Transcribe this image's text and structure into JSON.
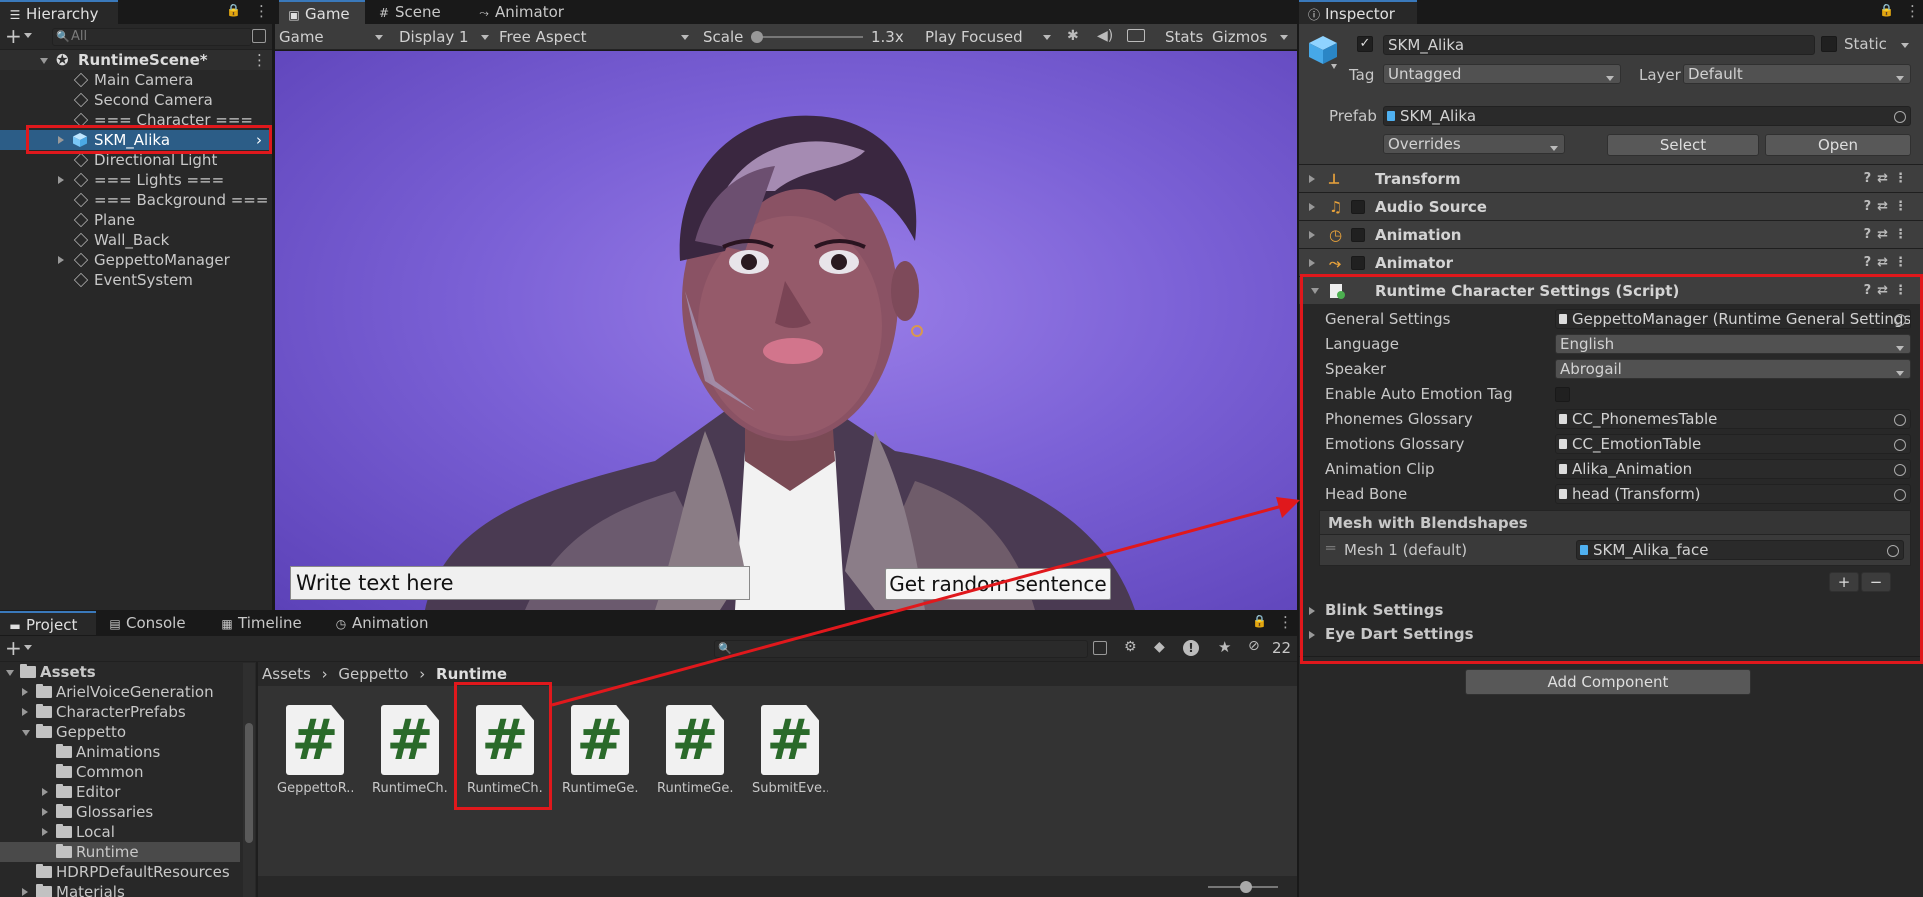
{
  "hierarchy": {
    "tab": "Hierarchy",
    "search_placeholder": "All",
    "scene": "RuntimeScene*",
    "items": [
      {
        "label": "Main Camera",
        "expandable": false
      },
      {
        "label": "Second Camera",
        "expandable": false
      },
      {
        "label": "=== Character ===",
        "expandable": false
      },
      {
        "label": "SKM_Alika",
        "expandable": true,
        "selected": true
      },
      {
        "label": "Directional Light",
        "expandable": false
      },
      {
        "label": "=== Lights ===",
        "expandable": true
      },
      {
        "label": "=== Background ===",
        "expandable": false
      },
      {
        "label": "Plane",
        "expandable": false
      },
      {
        "label": "Wall_Back",
        "expandable": false
      },
      {
        "label": "GeppettoManager",
        "expandable": true
      },
      {
        "label": "EventSystem",
        "expandable": false
      }
    ]
  },
  "game": {
    "tabs": [
      "Game",
      "Scene",
      "Animator"
    ],
    "mode": "Game",
    "display": "Display 1",
    "aspect": "Free Aspect",
    "scale_label": "Scale",
    "scale_value": "1.3x",
    "play_mode": "Play Focused",
    "stats": "Stats",
    "gizmos": "Gizmos",
    "text_input_placeholder": "Write text here",
    "random_button": "Get random sentence"
  },
  "project": {
    "tabs": [
      "Project",
      "Console",
      "Timeline",
      "Animation"
    ],
    "hidden_count": "22",
    "tree": [
      {
        "label": "Assets",
        "level": 0,
        "arrow": "down",
        "bold": true
      },
      {
        "label": "ArielVoiceGeneration",
        "level": 1,
        "arrow": "right"
      },
      {
        "label": "CharacterPrefabs",
        "level": 1,
        "arrow": "right"
      },
      {
        "label": "Geppetto",
        "level": 1,
        "arrow": "down"
      },
      {
        "label": "Animations",
        "level": 2,
        "arrow": ""
      },
      {
        "label": "Common",
        "level": 2,
        "arrow": ""
      },
      {
        "label": "Editor",
        "level": 2,
        "arrow": "right"
      },
      {
        "label": "Glossaries",
        "level": 2,
        "arrow": "right"
      },
      {
        "label": "Local",
        "level": 2,
        "arrow": "right"
      },
      {
        "label": "Runtime",
        "level": 2,
        "arrow": "",
        "selected": true
      },
      {
        "label": "HDRPDefaultResources",
        "level": 1,
        "arrow": ""
      },
      {
        "label": "Materials",
        "level": 1,
        "arrow": "right"
      }
    ],
    "breadcrumb": [
      "Assets",
      "Geppetto",
      "Runtime"
    ],
    "assets": [
      "GeppettoR...",
      "RuntimeCh...",
      "RuntimeCh...",
      "RuntimeGe...",
      "RuntimeGe...",
      "SubmitEve..."
    ],
    "asset_glyph": "#"
  },
  "inspector": {
    "tab": "Inspector",
    "object_name": "SKM_Alika",
    "static_label": "Static",
    "tag_label": "Tag",
    "tag_value": "Untagged",
    "layer_label": "Layer",
    "layer_value": "Default",
    "prefab_label": "Prefab",
    "prefab_value": "SKM_Alika",
    "overrides": "Overrides",
    "select": "Select",
    "open": "Open",
    "components": [
      "Transform",
      "Audio Source",
      "Animation",
      "Animator"
    ],
    "script": {
      "title": "Runtime Character Settings (Script)",
      "fields": [
        {
          "label": "General Settings",
          "value": "GeppettoManager (Runtime General Settings)",
          "kind": "object"
        },
        {
          "label": "Language",
          "value": "English",
          "kind": "dropdown"
        },
        {
          "label": "Speaker",
          "value": "Abrogail",
          "kind": "dropdown"
        },
        {
          "label": "Enable Auto Emotion Tag",
          "value": "",
          "kind": "checkbox"
        },
        {
          "label": "Phonemes Glossary",
          "value": "CC_PhonemesTable",
          "kind": "object"
        },
        {
          "label": "Emotions Glossary",
          "value": "CC_EmotionTable",
          "kind": "object"
        },
        {
          "label": "Animation Clip",
          "value": "Alika_Animation",
          "kind": "object"
        },
        {
          "label": "Head Bone",
          "value": "head (Transform)",
          "kind": "object"
        }
      ],
      "mesh_header": "Mesh with Blendshapes",
      "mesh_label": "Mesh 1 (default)",
      "mesh_value": "SKM_Alika_face",
      "plus": "+",
      "minus": "−",
      "foldouts": [
        "Blink Settings",
        "Eye Dart Settings"
      ]
    },
    "add_component": "Add Component"
  },
  "colors": {
    "accent_selection": "#2c5d87",
    "highlight_red": "#e0181c",
    "viewport_purple": "#7a5fd4"
  }
}
